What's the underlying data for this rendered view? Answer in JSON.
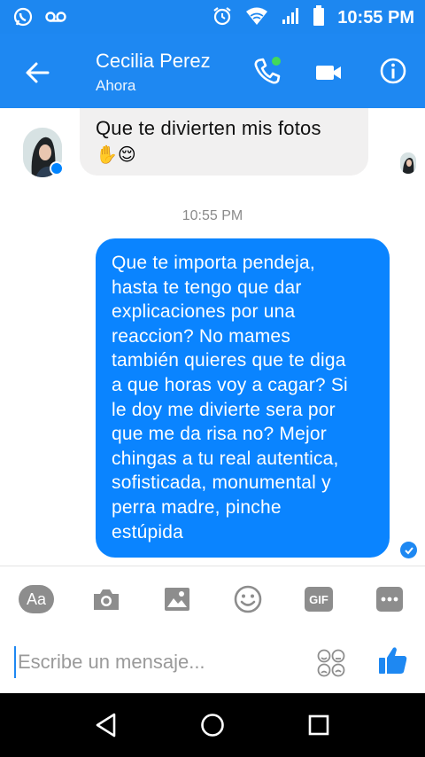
{
  "status_bar": {
    "time": "10:55 PM"
  },
  "header": {
    "contact_name": "Cecilia Perez",
    "contact_status": "Ahora"
  },
  "messages": [
    {
      "direction": "incoming",
      "text": "Que te divierten mis fotos",
      "emoji": "✋😌"
    },
    {
      "type": "timestamp",
      "text": "10:55 PM"
    },
    {
      "direction": "outgoing",
      "lines": [
        "Que te importa pendeja,",
        "hasta te tengo que dar",
        "explicaciones por una",
        "reaccion? No mames",
        "también quieres que te diga",
        "a que horas voy a cagar? Si",
        "le doy me divierte sera por",
        "que me da risa no? Mejor",
        "chingas a tu real autentica,",
        "sofisticada, monumental y",
        "perra madre, pinche",
        "estúpida"
      ]
    }
  ],
  "composer": {
    "aa_label": "Aa",
    "gif_label": "GIF",
    "placeholder": "Escribe un mensaje..."
  },
  "colors": {
    "brand_blue": "#1e88f2",
    "outgoing_bubble": "#0a84ff",
    "incoming_bubble": "#f1f0f0"
  }
}
